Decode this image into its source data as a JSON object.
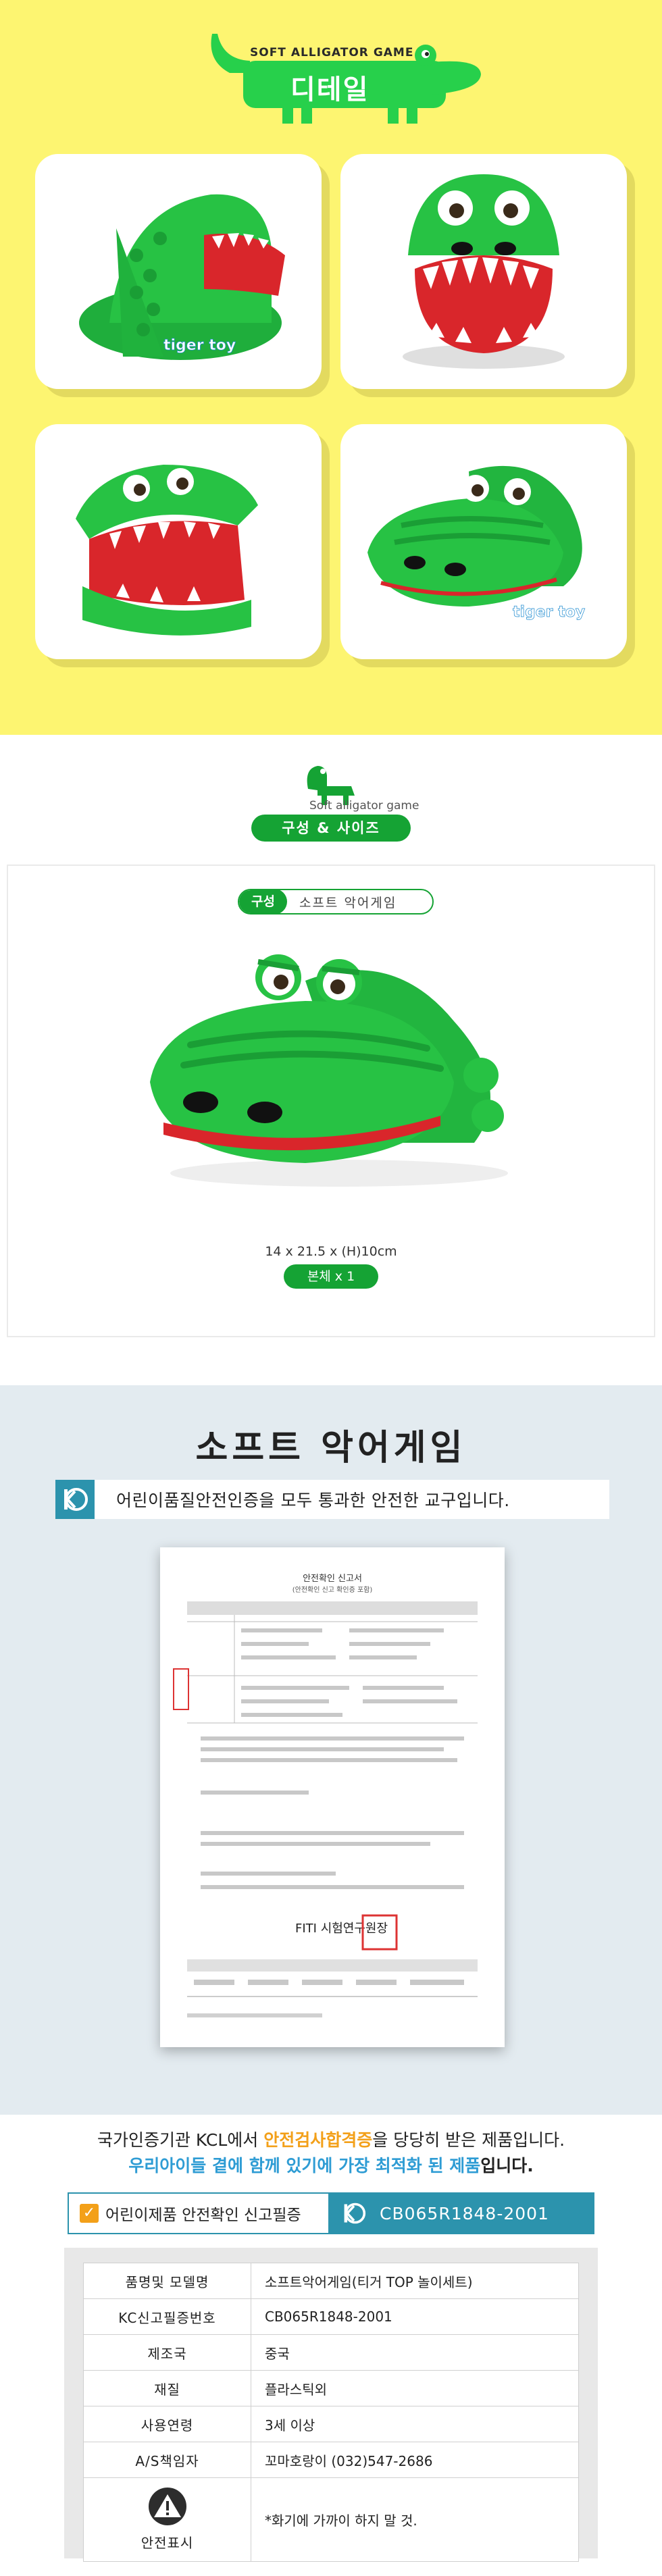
{
  "detail": {
    "subtitle_en": "SOFT ALLIGATOR GAME",
    "title_ko": "디테일",
    "watermark": "tiger toy",
    "colors": {
      "background": "#fdf571",
      "brand_green": "#27d04b",
      "card": "#ffffff"
    }
  },
  "compose": {
    "subtitle_en": "Soft alligator game",
    "title_ko": "구성 & 사이즈",
    "tag_label": "구성",
    "tag_name": "소프트 악어게임",
    "dimensions": "14 x 21.5 x (H)10cm",
    "count": "본체 x 1"
  },
  "safety": {
    "title": "소프트 악어게임",
    "kc_banner": "어린이품질안전인증을 모두 통과한 안전한 교구입니다.",
    "certificate": {
      "title": "안전확인 신고서",
      "subtitle": "(안전확인 신고 확인증 포함)",
      "org_footer": "FITI 시험연구원장"
    }
  },
  "kcl": {
    "line1_a": "국가인증기관 KCL에서 ",
    "line1_hl": "안전검사합격증",
    "line1_b": "을 당당히 받은 제품입니다.",
    "line2_blue": "우리아이들 곁에 함께 있기에 가장 최적화 된 제품",
    "line2_b": "입니다.",
    "report_label": "어린이제품 안전확인 신고필증",
    "report_number": "CB065R1848-2001",
    "spec": [
      {
        "key": "품명및 모델명",
        "value": "소프트악어게임(티거 TOP 놀이세트)"
      },
      {
        "key": "KC신고필증번호",
        "value": "CB065R1848-2001"
      },
      {
        "key": "제조국",
        "value": "중국"
      },
      {
        "key": "재질",
        "value": "플라스틱외"
      },
      {
        "key": "사용연령",
        "value": "3세 이상"
      },
      {
        "key": "A/S책임자",
        "value": "꼬마호랑이 (032)547-2686"
      }
    ],
    "warning_key": "안전표시",
    "warning_value": "*화기에 가까이 하지 말 것.",
    "icons": [
      "check-icon",
      "kc-mark-icon",
      "warning-icon"
    ]
  }
}
